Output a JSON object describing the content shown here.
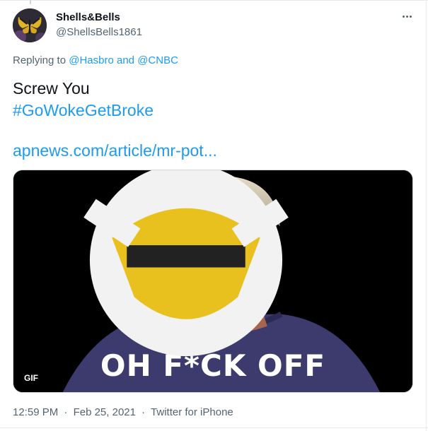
{
  "tweet": {
    "author_name": "Shells&Bells",
    "author_handle": "@ShellsBells1861",
    "replying_prefix": "Replying to",
    "replying_user_1": "@Hasbro",
    "replying_and": "and",
    "replying_user_2": "@CNBC",
    "text_line_1": "Screw You",
    "hashtag": "#GoWokeGetBroke",
    "link_text": "apnews.com/article/mr-pot...",
    "media": {
      "caption": "OH F*CK OFF",
      "badge": "GIF"
    },
    "time": "12:59 PM",
    "date": "Feb 25, 2021",
    "separator": "·",
    "source": "Twitter for iPhone"
  },
  "colors": {
    "accent": "#1d9bf0",
    "secondary_text": "#536471",
    "primary_text": "#0f1419"
  },
  "icons": {
    "more": "more-horizontal-icon",
    "avatar": "butterfly-avatar",
    "media_logo": "channel-logo-icon"
  }
}
